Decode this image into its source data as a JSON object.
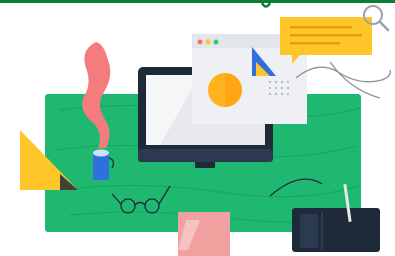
{
  "illustration": {
    "accent_colors": {
      "top_bar": "#0a7d36",
      "desk_green": "#1fb870",
      "desk_green_dark": "#15995a",
      "navy": "#1e2a3a",
      "screen_gray": "#e6e8eb",
      "window_bg": "#eef0f3",
      "yellow": "#ffc629",
      "orange": "#ffb21e",
      "blue": "#2f6fe0",
      "coral": "#f47c7c",
      "pink_pad": "#f2a1a1",
      "dot_red": "#ff6b6b",
      "dot_yellow": "#ffc629",
      "dot_green": "#31c48d"
    },
    "icons": [
      "monitor-icon",
      "browser-window-icon",
      "chat-bubble-icon",
      "magnifier-icon",
      "eyeglasses-icon",
      "triangle-shape",
      "smoke-plume",
      "graphics-tablet-icon",
      "sticky-note-icon"
    ]
  }
}
